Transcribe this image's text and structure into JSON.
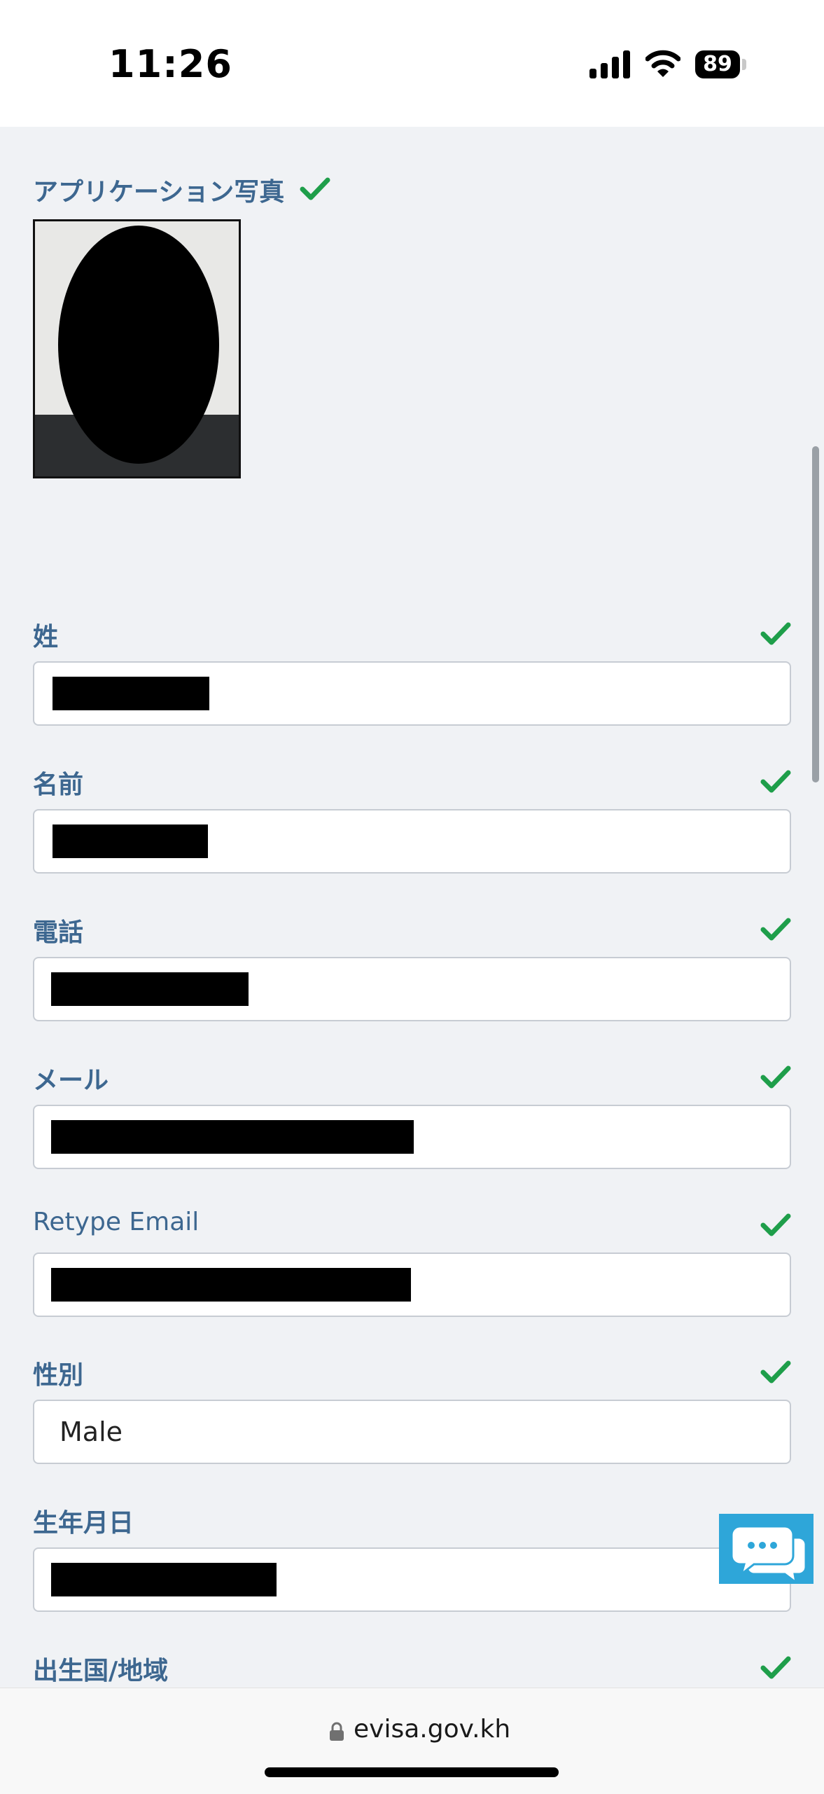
{
  "status_bar": {
    "time": "11:26",
    "battery": "89",
    "icons": [
      "cellular-signal-icon",
      "wifi-icon",
      "battery-icon"
    ]
  },
  "photo": {
    "title": "アプリケーション写真",
    "validated": true
  },
  "fields": {
    "surname": {
      "label": "姓",
      "value": "",
      "redacted": true
    },
    "given_name": {
      "label": "名前",
      "value": "",
      "redacted": true
    },
    "phone": {
      "label": "電話",
      "value": "",
      "redacted": true
    },
    "email": {
      "label": "メール",
      "value": "",
      "redacted": true
    },
    "retype_email": {
      "label": "Retype Email",
      "value": "",
      "redacted": true
    },
    "gender": {
      "label": "性別",
      "value": "Male"
    },
    "dob": {
      "label": "生年月日",
      "value": "",
      "redacted": true
    },
    "birth_country": {
      "label": "出生国/地域"
    }
  },
  "url_bar": {
    "domain": "evisa.gov.kh"
  },
  "colors": {
    "label": "#3d6790",
    "check": "#1e9e4a",
    "background": "#f0f2f5",
    "chat_button": "#2ea6d9"
  }
}
